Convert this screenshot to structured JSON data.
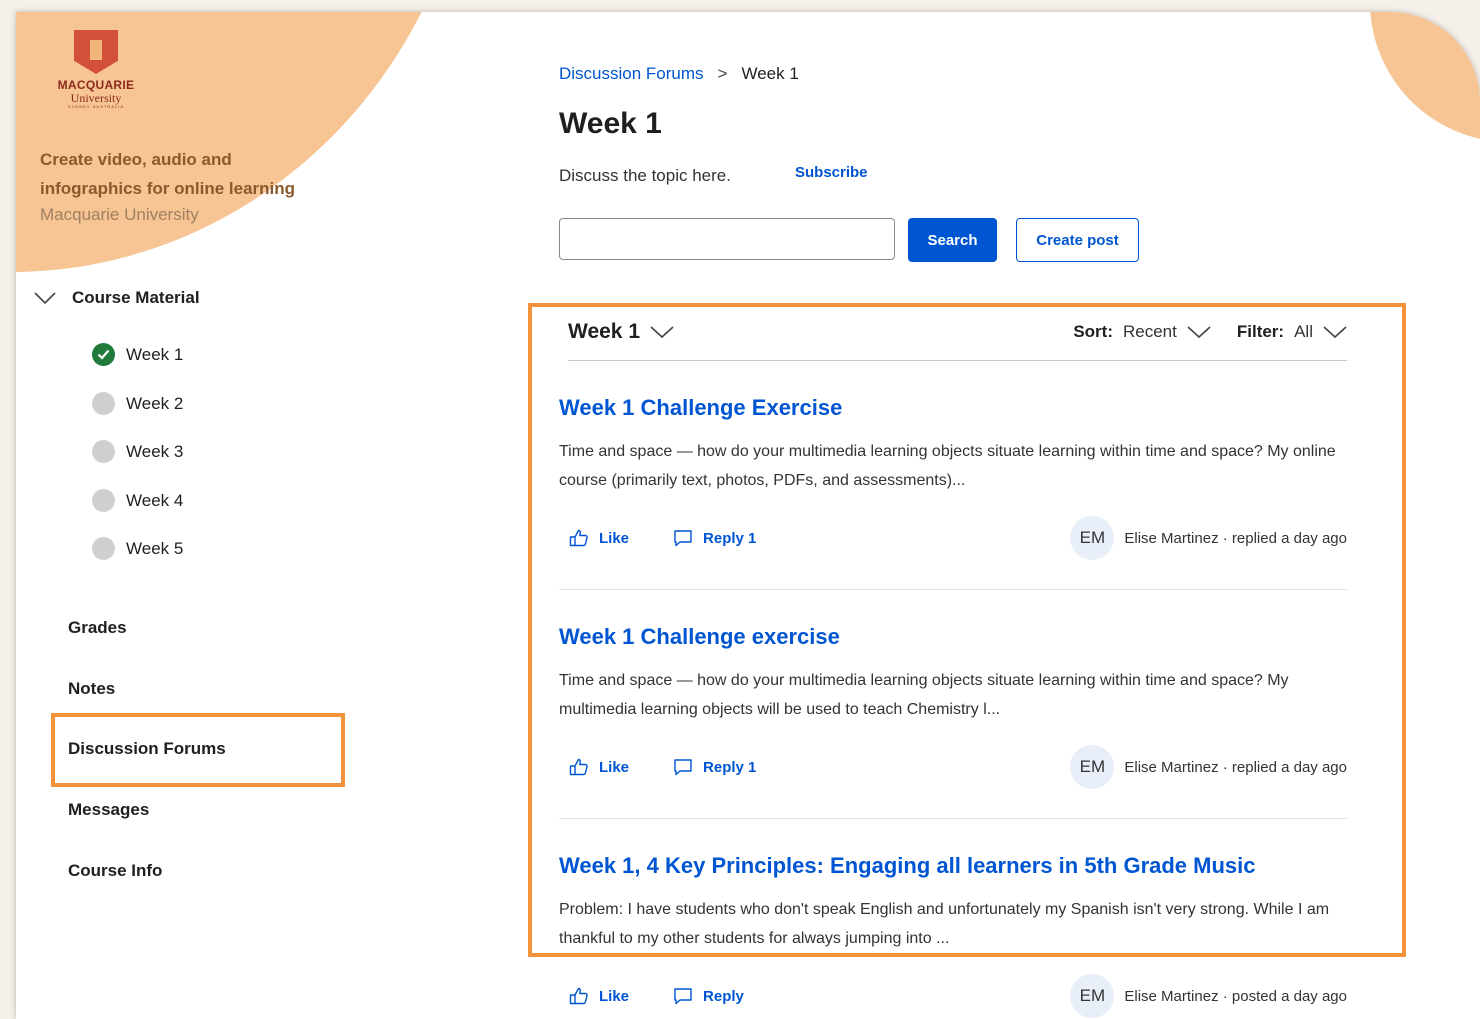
{
  "sidebar": {
    "logo": {
      "line1": "MACQUARIE",
      "line2": "University",
      "line3": "SYDNEY·AUSTRALIA"
    },
    "course_title": "Create video, audio and infographics for online learning",
    "course_org": "Macquarie University",
    "section_label": "Course Material",
    "weeks": [
      {
        "label": "Week 1",
        "completed": true
      },
      {
        "label": "Week 2",
        "completed": false
      },
      {
        "label": "Week 3",
        "completed": false
      },
      {
        "label": "Week 4",
        "completed": false
      },
      {
        "label": "Week 5",
        "completed": false
      }
    ],
    "links": [
      "Grades",
      "Notes",
      "Discussion Forums",
      "Messages",
      "Course Info"
    ]
  },
  "breadcrumb": {
    "parent": "Discussion Forums",
    "separator": ">",
    "current": "Week 1"
  },
  "page": {
    "title": "Week 1",
    "description": "Discuss the topic here.",
    "subscribe_label": "Subscribe",
    "search_value": "",
    "search_label": "Search",
    "create_post_label": "Create post"
  },
  "list_header": {
    "week_filter": "Week 1",
    "sort_label": "Sort:",
    "sort_value": "Recent",
    "filter_label": "Filter:",
    "filter_value": "All"
  },
  "posts": [
    {
      "title": "Week 1 Challenge Exercise",
      "excerpt": "Time and space — how do your multimedia learning objects situate learning within time and space? My online course (primarily text, photos, PDFs, and assessments)...",
      "like_label": "Like",
      "reply_label": "Reply 1",
      "avatar": "EM",
      "meta": "Elise Martinez · replied a day ago"
    },
    {
      "title": "Week 1 Challenge exercise",
      "excerpt": "Time and space — how do your multimedia learning objects situate learning within time and space? My multimedia learning objects will be used to teach Chemistry l...",
      "like_label": "Like",
      "reply_label": "Reply 1",
      "avatar": "EM",
      "meta": "Elise Martinez · replied a day ago"
    },
    {
      "title": "Week 1, 4 Key Principles: Engaging all learners in 5th Grade Music",
      "excerpt": "Problem: I have students who don't speak English and unfortunately my Spanish isn't very strong. While I am thankful to my other students for always jumping into ...",
      "like_label": "Like",
      "reply_label": "Reply",
      "avatar": "EM",
      "meta": "Elise Martinez · posted a day ago"
    }
  ],
  "colors": {
    "accent": "#0056d2",
    "highlight": "#f2923a",
    "decor": "#f7c494",
    "success": "#1f7a3c"
  }
}
